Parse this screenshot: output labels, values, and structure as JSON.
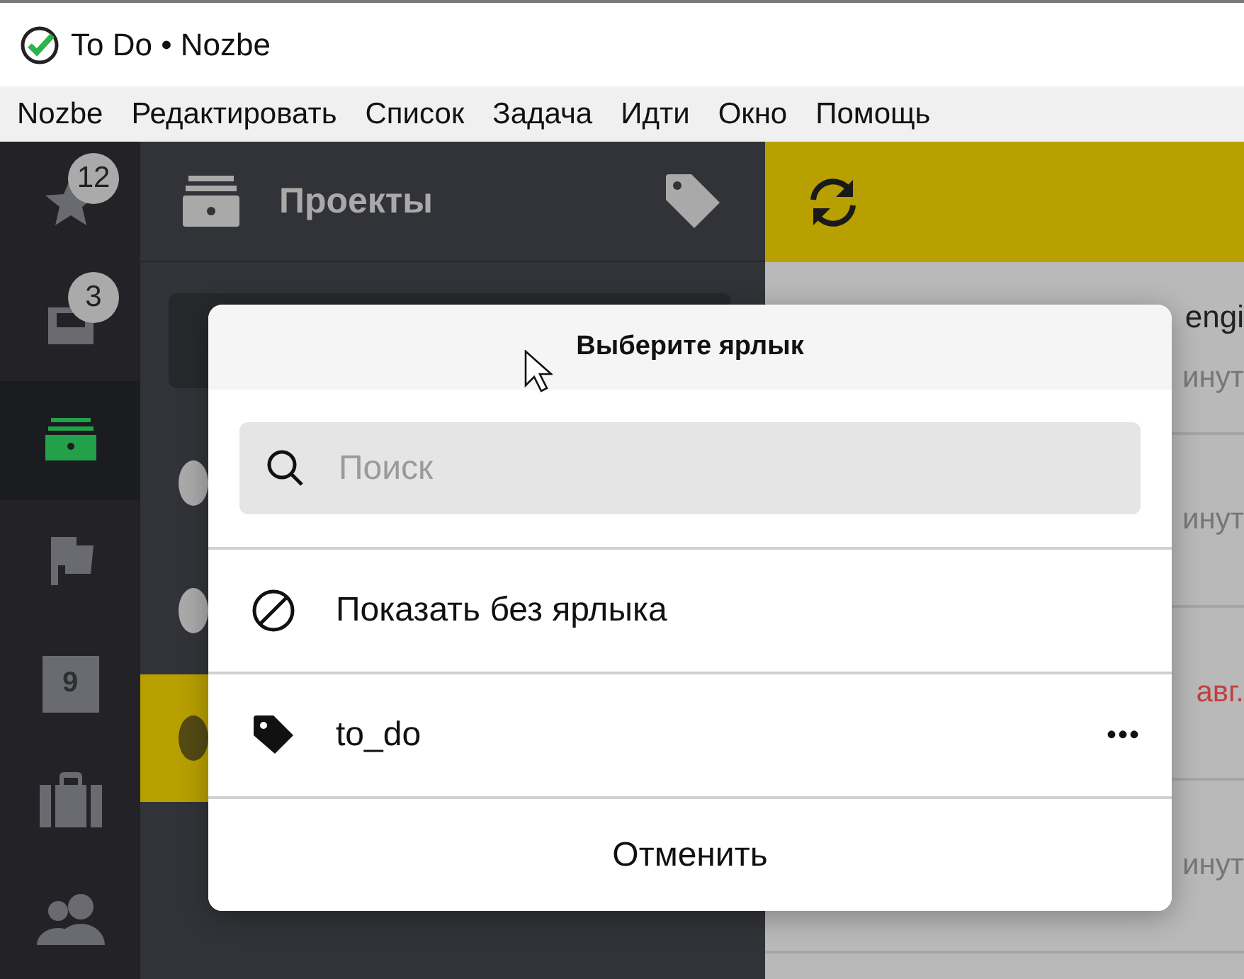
{
  "window": {
    "title": "To Do • Nozbe"
  },
  "menu": [
    "Nozbe",
    "Редактировать",
    "Список",
    "Задача",
    "Идти",
    "Окно",
    "Помощь"
  ],
  "rail": [
    {
      "kind": "star",
      "badge": "12",
      "selected": false
    },
    {
      "kind": "inbox",
      "badge": "3",
      "selected": false
    },
    {
      "kind": "projects",
      "selected": true
    },
    {
      "kind": "flag",
      "selected": false
    },
    {
      "kind": "calendar",
      "label": "9",
      "selected": false
    },
    {
      "kind": "briefcase",
      "selected": false
    },
    {
      "kind": "people",
      "selected": false
    }
  ],
  "projects": {
    "title": "Проекты",
    "rows": [
      {
        "selected": false
      },
      {
        "selected": false
      },
      {
        "selected": true
      }
    ]
  },
  "tasks": {
    "rows": [
      {
        "title": "engi",
        "meta": "инут",
        "overdue": false
      },
      {
        "meta": "инут",
        "overdue": false
      },
      {
        "meta": "авг.",
        "overdue": true
      },
      {
        "meta": "инут",
        "overdue": false
      }
    ]
  },
  "dialog": {
    "title": "Выберите ярлык",
    "search": {
      "placeholder": "Поиск"
    },
    "options": [
      {
        "kind": "none",
        "label": "Показать без ярлыка"
      },
      {
        "kind": "tag",
        "label": "to_do",
        "more": "•••"
      }
    ],
    "cancel": "Отменить"
  }
}
